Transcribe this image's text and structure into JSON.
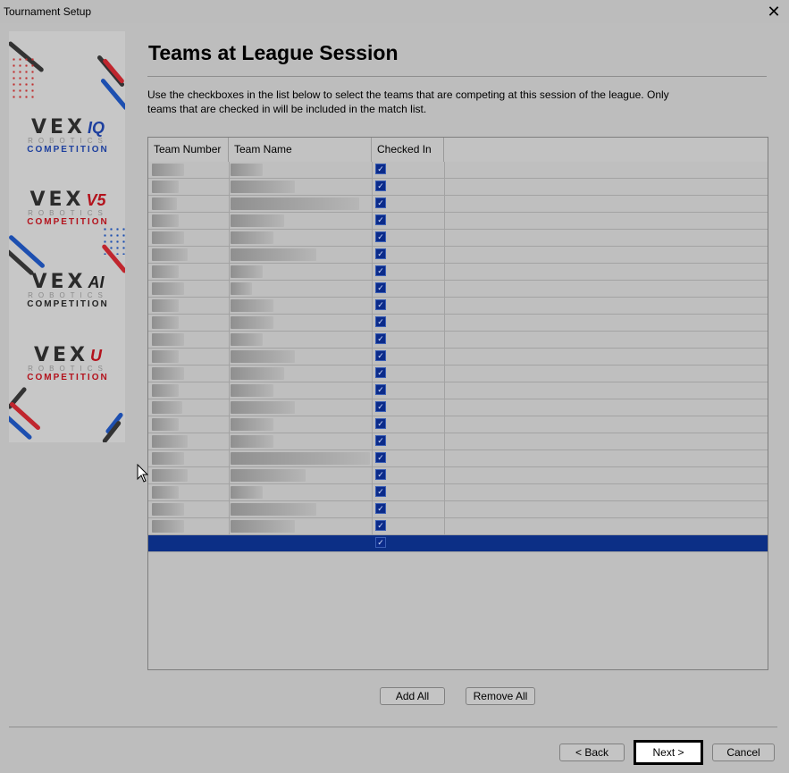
{
  "window": {
    "title": "Tournament Setup",
    "close_glyph": "✕"
  },
  "sidebar": {
    "logos": [
      {
        "vex": "VEX",
        "tag": "IQ",
        "tag_color": "#1d3f9e",
        "robotics": "ROBOTICS",
        "competition": "COMPETITION",
        "comp_color": "#1d3f9e"
      },
      {
        "vex": "VEX",
        "tag": "V5",
        "tag_color": "#b3121c",
        "robotics": "ROBOTICS",
        "competition": "COMPETITION",
        "comp_color": "#b3121c"
      },
      {
        "vex": "VEX",
        "tag": "AI",
        "tag_color": "#222222",
        "robotics": "ROBOTICS",
        "competition": "COMPETITION",
        "comp_color": "#222222"
      },
      {
        "vex": "VEX",
        "tag": "U",
        "tag_color": "#b3121c",
        "robotics": "ROBOTICS",
        "competition": "COMPETITION",
        "comp_color": "#b3121c"
      }
    ]
  },
  "page": {
    "heading": "Teams at League Session",
    "instructions": "Use the checkboxes in the list below to select the teams that are competing at this session of the league.  Only teams that are checked in will be included in the match list."
  },
  "table": {
    "columns": [
      "Team Number",
      "Team Name",
      "Checked In"
    ],
    "rows": [
      {
        "num_w": 36,
        "name_w": 36,
        "checked": true
      },
      {
        "num_w": 30,
        "name_w": 72,
        "checked": true
      },
      {
        "num_w": 28,
        "name_w": 144,
        "checked": true
      },
      {
        "num_w": 30,
        "name_w": 60,
        "checked": true
      },
      {
        "num_w": 36,
        "name_w": 48,
        "checked": true
      },
      {
        "num_w": 40,
        "name_w": 96,
        "checked": true
      },
      {
        "num_w": 30,
        "name_w": 36,
        "checked": true
      },
      {
        "num_w": 36,
        "name_w": 24,
        "checked": true
      },
      {
        "num_w": 30,
        "name_w": 48,
        "checked": true
      },
      {
        "num_w": 30,
        "name_w": 48,
        "checked": true
      },
      {
        "num_w": 36,
        "name_w": 36,
        "checked": true
      },
      {
        "num_w": 30,
        "name_w": 72,
        "checked": true
      },
      {
        "num_w": 36,
        "name_w": 60,
        "checked": true
      },
      {
        "num_w": 30,
        "name_w": 48,
        "checked": true
      },
      {
        "num_w": 34,
        "name_w": 72,
        "checked": true
      },
      {
        "num_w": 30,
        "name_w": 48,
        "checked": true
      },
      {
        "num_w": 40,
        "name_w": 48,
        "checked": true
      },
      {
        "num_w": 36,
        "name_w": 156,
        "checked": true
      },
      {
        "num_w": 40,
        "name_w": 84,
        "checked": true
      },
      {
        "num_w": 30,
        "name_w": 36,
        "checked": true
      },
      {
        "num_w": 36,
        "name_w": 96,
        "checked": true
      },
      {
        "num_w": 36,
        "name_w": 72,
        "checked": true
      },
      {
        "num_w": 0,
        "name_w": 0,
        "checked": true,
        "selected": true
      }
    ],
    "check_glyph": "✓"
  },
  "buttons": {
    "add_all": "Add All",
    "remove_all": "Remove All",
    "back": "< Back",
    "next": "Next >",
    "cancel": "Cancel"
  },
  "colors": {
    "accent": "#0c2f86",
    "checkbox": "#0b2b8a",
    "background": "#bdbdbd"
  },
  "icons": {
    "cursor": "mouse-pointer-icon"
  }
}
